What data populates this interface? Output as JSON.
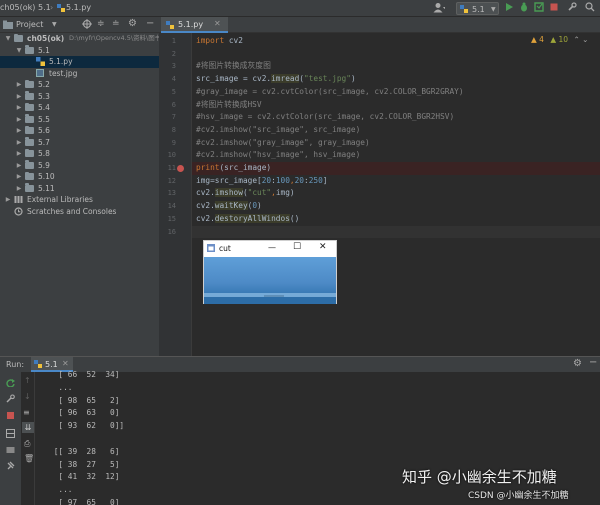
{
  "navbar": {
    "crumbs": [
      "ch05(ok)",
      "5.1",
      "5.1.py"
    ],
    "run_config": "5.1",
    "user_icon": "user-icon"
  },
  "project_panel": {
    "title": "Project",
    "tree": [
      {
        "label": "ch05(ok)",
        "path": "D:\\myfr\\Opencv4.5\\资料\\图书资",
        "type": "folder",
        "expanded": true,
        "indent": 0
      },
      {
        "label": "5.1",
        "type": "folder",
        "expanded": true,
        "indent": 1
      },
      {
        "label": "5.1.py",
        "type": "py",
        "indent": 2,
        "selected": true
      },
      {
        "label": "test.jpg",
        "type": "img",
        "indent": 2
      },
      {
        "label": "5.2",
        "type": "folder",
        "expanded": false,
        "indent": 1
      },
      {
        "label": "5.3",
        "type": "folder",
        "expanded": false,
        "indent": 1
      },
      {
        "label": "5.4",
        "type": "folder",
        "expanded": false,
        "indent": 1
      },
      {
        "label": "5.5",
        "type": "folder",
        "expanded": false,
        "indent": 1
      },
      {
        "label": "5.6",
        "type": "folder",
        "expanded": false,
        "indent": 1
      },
      {
        "label": "5.7",
        "type": "folder",
        "expanded": false,
        "indent": 1
      },
      {
        "label": "5.8",
        "type": "folder",
        "expanded": false,
        "indent": 1
      },
      {
        "label": "5.9",
        "type": "folder",
        "expanded": false,
        "indent": 1
      },
      {
        "label": "5.10",
        "type": "folder",
        "expanded": false,
        "indent": 1
      },
      {
        "label": "5.11",
        "type": "folder",
        "expanded": false,
        "indent": 1
      },
      {
        "label": "External Libraries",
        "type": "lib",
        "expanded": false,
        "indent": 0
      },
      {
        "label": "Scratches and Consoles",
        "type": "scratch",
        "indent": 0
      }
    ]
  },
  "editor": {
    "tab_label": "5.1.py",
    "inspection": {
      "warnings": "4",
      "weak_warnings": "10"
    },
    "lines": [
      [
        {
          "t": "import ",
          "c": "kw"
        },
        {
          "t": "cv2",
          "c": "tx"
        }
      ],
      [],
      [
        {
          "t": "#将图片转换成灰度图",
          "c": "cm"
        }
      ],
      [
        {
          "t": "src_image = cv2.",
          "c": "tx"
        },
        {
          "t": "imread",
          "c": "fn-hl"
        },
        {
          "t": "(",
          "c": "tx"
        },
        {
          "t": "\"test.jpg\"",
          "c": "st"
        },
        {
          "t": ")",
          "c": "tx"
        }
      ],
      [
        {
          "t": "#gray_image = cv2.cvtColor(src_image, cv2.COLOR_BGR2GRAY)",
          "c": "cm"
        }
      ],
      [
        {
          "t": "#将图片转换成HSV",
          "c": "cm"
        }
      ],
      [
        {
          "t": "#hsv_image = cv2.cvtColor(src_image, cv2.COLOR_BGR2HSV)",
          "c": "cm"
        }
      ],
      [
        {
          "t": "#cv2.imshow(\"src_image\", src_image)",
          "c": "cm"
        }
      ],
      [
        {
          "t": "#cv2.imshow(\"gray_image\", gray_image)",
          "c": "cm"
        }
      ],
      [
        {
          "t": "#cv2.imshow(\"hsv_image\", hsv_image)",
          "c": "cm"
        }
      ],
      [
        {
          "t": "print",
          "c": "kw"
        },
        {
          "t": "(src_image)",
          "c": "tx"
        }
      ],
      [
        {
          "t": "img=src_image[",
          "c": "tx"
        },
        {
          "t": "20",
          "c": "nm"
        },
        {
          "t": ":",
          "c": "tx"
        },
        {
          "t": "100",
          "c": "nm"
        },
        {
          "t": ",",
          "c": "kw"
        },
        {
          "t": "20",
          "c": "nm"
        },
        {
          "t": ":",
          "c": "tx"
        },
        {
          "t": "250",
          "c": "nm"
        },
        {
          "t": "]",
          "c": "tx"
        }
      ],
      [
        {
          "t": "cv2.",
          "c": "tx"
        },
        {
          "t": "imshow",
          "c": "fn-hl"
        },
        {
          "t": "(",
          "c": "tx"
        },
        {
          "t": "\"cut\"",
          "c": "st"
        },
        {
          "t": ",",
          "c": "kw"
        },
        {
          "t": "img)",
          "c": "tx"
        }
      ],
      [
        {
          "t": "cv2.",
          "c": "tx"
        },
        {
          "t": "waitKey",
          "c": "fn-hl"
        },
        {
          "t": "(",
          "c": "tx"
        },
        {
          "t": "0",
          "c": "nm"
        },
        {
          "t": ")",
          "c": "tx"
        }
      ],
      [
        {
          "t": "cv2.",
          "c": "tx"
        },
        {
          "t": "destoryAllWindos",
          "c": "fn-hl"
        },
        {
          "t": "()",
          "c": "tx"
        }
      ],
      []
    ],
    "breakpoint_line": 11
  },
  "cut_window": {
    "title": "cut",
    "minimize": "—",
    "maximize": "☐",
    "close": "✕"
  },
  "run_panel": {
    "label": "Run:",
    "tab": "5.1",
    "console": [
      "  [ 66  52  34]",
      "  ...",
      "  [ 98  65   2]",
      "  [ 96  63   0]",
      "  [ 93  62   0]]",
      "",
      " [[ 39  28   6]",
      "  [ 38  27   5]",
      "  [ 41  32  12]",
      "  ...",
      "  [ 97  65   0]"
    ]
  },
  "watermark": {
    "main": "知乎 @小幽余生不加糖",
    "sub": "CSDN @小幽余生不加糖"
  },
  "colors": {
    "accent": "#4a88c7",
    "breakpoint": "#c75450",
    "run_green": "#499c54"
  }
}
